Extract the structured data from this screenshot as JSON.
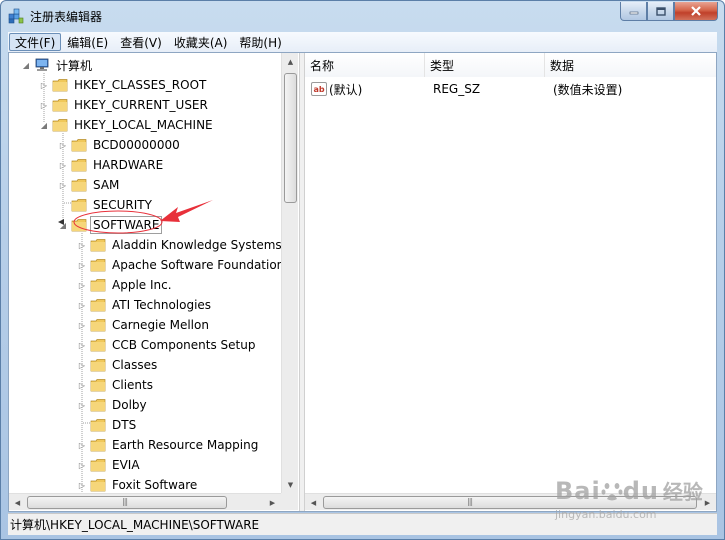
{
  "window": {
    "title": "注册表编辑器"
  },
  "menu": [
    {
      "label": "文件(F)",
      "active": true
    },
    {
      "label": "编辑(E)"
    },
    {
      "label": "查看(V)"
    },
    {
      "label": "收藏夹(A)"
    },
    {
      "label": "帮助(H)"
    }
  ],
  "tree": {
    "root": "计算机",
    "level1": [
      "HKEY_CLASSES_ROOT",
      "HKEY_CURRENT_USER",
      "HKEY_LOCAL_MACHINE"
    ],
    "hklm_children": [
      "BCD00000000",
      "HARDWARE",
      "SAM",
      "SECURITY",
      "SOFTWARE"
    ],
    "software_children": [
      "Aladdin Knowledge Systems",
      "Apache Software Foundation",
      "Apple Inc.",
      "ATI Technologies",
      "Carnegie Mellon",
      "CCB Components Setup",
      "Classes",
      "Clients",
      "Dolby",
      "DTS",
      "Earth Resource Mapping",
      "EVIA",
      "Foxit Software"
    ],
    "selected": "SOFTWARE"
  },
  "list": {
    "columns": [
      "名称",
      "类型",
      "数据"
    ],
    "rows": [
      {
        "name": "(默认)",
        "type": "REG_SZ",
        "data": "(数值未设置)"
      }
    ]
  },
  "status": {
    "path": "计算机\\HKEY_LOCAL_MACHINE\\SOFTWARE"
  },
  "watermark": {
    "brand": "Bai",
    "brand2": "du",
    "cn": "经验",
    "sub": "jingyan.baidu.com"
  },
  "colors": {
    "annotation": "#e8303a",
    "folder": "#f0c85a",
    "title_bar": "#b7cfe9"
  }
}
